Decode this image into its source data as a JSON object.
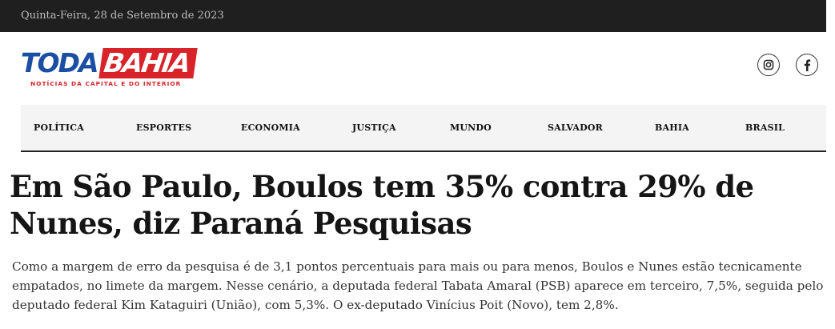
{
  "topbar": {
    "date": "Quinta-Feira, 28 de Setembro de 2023"
  },
  "logo": {
    "part1": "TODA",
    "part2": "BAHIA",
    "tagline": "NOTÍCIAS DA CAPITAL E DO INTERIOR",
    "colors": {
      "blue": "#1c4fa3",
      "red": "#d9232a"
    }
  },
  "social": [
    {
      "icon": "instagram-icon"
    },
    {
      "icon": "facebook-icon"
    }
  ],
  "nav": {
    "items": [
      {
        "label": "POLÍTICA"
      },
      {
        "label": "ESPORTES"
      },
      {
        "label": "ECONOMIA"
      },
      {
        "label": "JUSTIÇA"
      },
      {
        "label": "MUNDO"
      },
      {
        "label": "SALVADOR"
      },
      {
        "label": "BAHIA"
      },
      {
        "label": "BRASIL"
      }
    ]
  },
  "article": {
    "title": "Em São Paulo, Boulos tem 35% contra 29% de Nunes, diz Paraná Pesquisas",
    "body": "Como a margem de erro da pesquisa é de 3,1 pontos percentuais para mais ou para menos, Boulos e Nunes estão tecnicamente empatados, no limete da margem. Nesse cenário, a deputada federal Tabata Amaral (PSB) aparece em terceiro, 7,5%, seguida pelo deputado federal Kim Kataguiri (União), com 5,3%. O ex-deputado Vinícius Poit (Novo), tem 2,8%."
  }
}
